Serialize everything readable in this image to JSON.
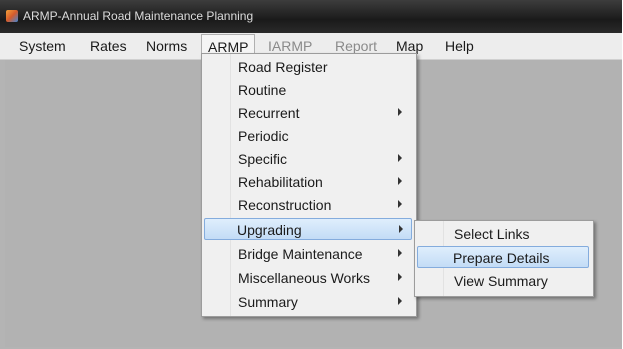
{
  "window": {
    "title": "ARMP-Annual Road Maintenance Planning"
  },
  "menubar": {
    "items": [
      {
        "label": "System"
      },
      {
        "label": "Rates"
      },
      {
        "label": "Norms"
      },
      {
        "label": "ARMP"
      },
      {
        "label": "IARMP"
      },
      {
        "label": "Report"
      },
      {
        "label": "Map"
      },
      {
        "label": "Help"
      }
    ]
  },
  "armp_menu": {
    "items": [
      {
        "label": "Road Register"
      },
      {
        "label": "Routine"
      },
      {
        "label": "Recurrent"
      },
      {
        "label": "Periodic"
      },
      {
        "label": "Specific"
      },
      {
        "label": "Rehabilitation"
      },
      {
        "label": "Reconstruction"
      },
      {
        "label": "Upgrading"
      },
      {
        "label": "Bridge Maintenance"
      },
      {
        "label": "Miscellaneous Works"
      },
      {
        "label": "Summary"
      }
    ]
  },
  "upgrading_submenu": {
    "items": [
      {
        "label": "Select Links"
      },
      {
        "label": "Prepare Details"
      },
      {
        "label": "View Summary"
      }
    ]
  }
}
